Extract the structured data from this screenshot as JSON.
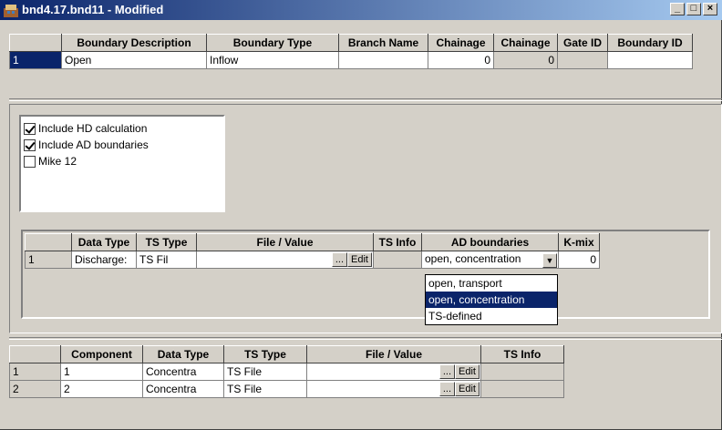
{
  "window": {
    "title": "bnd4.17.bnd11 - Modified",
    "minimize": "_",
    "maximize": "□",
    "close": "×"
  },
  "boundary_table": {
    "headers": [
      "",
      "Boundary Description",
      "Boundary Type",
      "Branch Name",
      "Chainage",
      "Chainage",
      "Gate ID",
      "Boundary ID"
    ],
    "rows": [
      {
        "num": "1",
        "description": "Open",
        "type": "Inflow",
        "branch": "",
        "chainage1": "0",
        "chainage2": "0",
        "gate": "",
        "boundary_id": ""
      }
    ]
  },
  "options": {
    "include_hd": "Include HD calculation",
    "include_ad": "Include AD boundaries",
    "mike12": "Mike 12",
    "include_hd_checked": true,
    "include_ad_checked": true,
    "mike12_checked": false
  },
  "ts_table": {
    "headers": [
      "",
      "Data Type",
      "TS Type",
      "File / Value",
      "TS Info",
      "AD boundaries",
      "K-mix"
    ],
    "rows": [
      {
        "num": "1",
        "data_type": "Discharge:",
        "ts_type": "TS Fil",
        "file": "",
        "browse": "...",
        "edit": "Edit",
        "ts_info": "",
        "ad": "open, concentration",
        "kmix": "0"
      }
    ]
  },
  "ad_dropdown": {
    "options": [
      "open, transport",
      "open, concentration",
      "TS-defined"
    ],
    "selected_index": 1
  },
  "component_table": {
    "headers": [
      "",
      "Component",
      "Data Type",
      "TS Type",
      "File / Value",
      "TS Info"
    ],
    "rows": [
      {
        "num": "1",
        "component": "1",
        "data_type": "Concentra",
        "ts_type": "TS File",
        "file": "",
        "browse": "...",
        "edit": "Edit",
        "ts_info": ""
      },
      {
        "num": "2",
        "component": "2",
        "data_type": "Concentra",
        "ts_type": "TS File",
        "file": "",
        "browse": "...",
        "edit": "Edit",
        "ts_info": ""
      }
    ]
  }
}
